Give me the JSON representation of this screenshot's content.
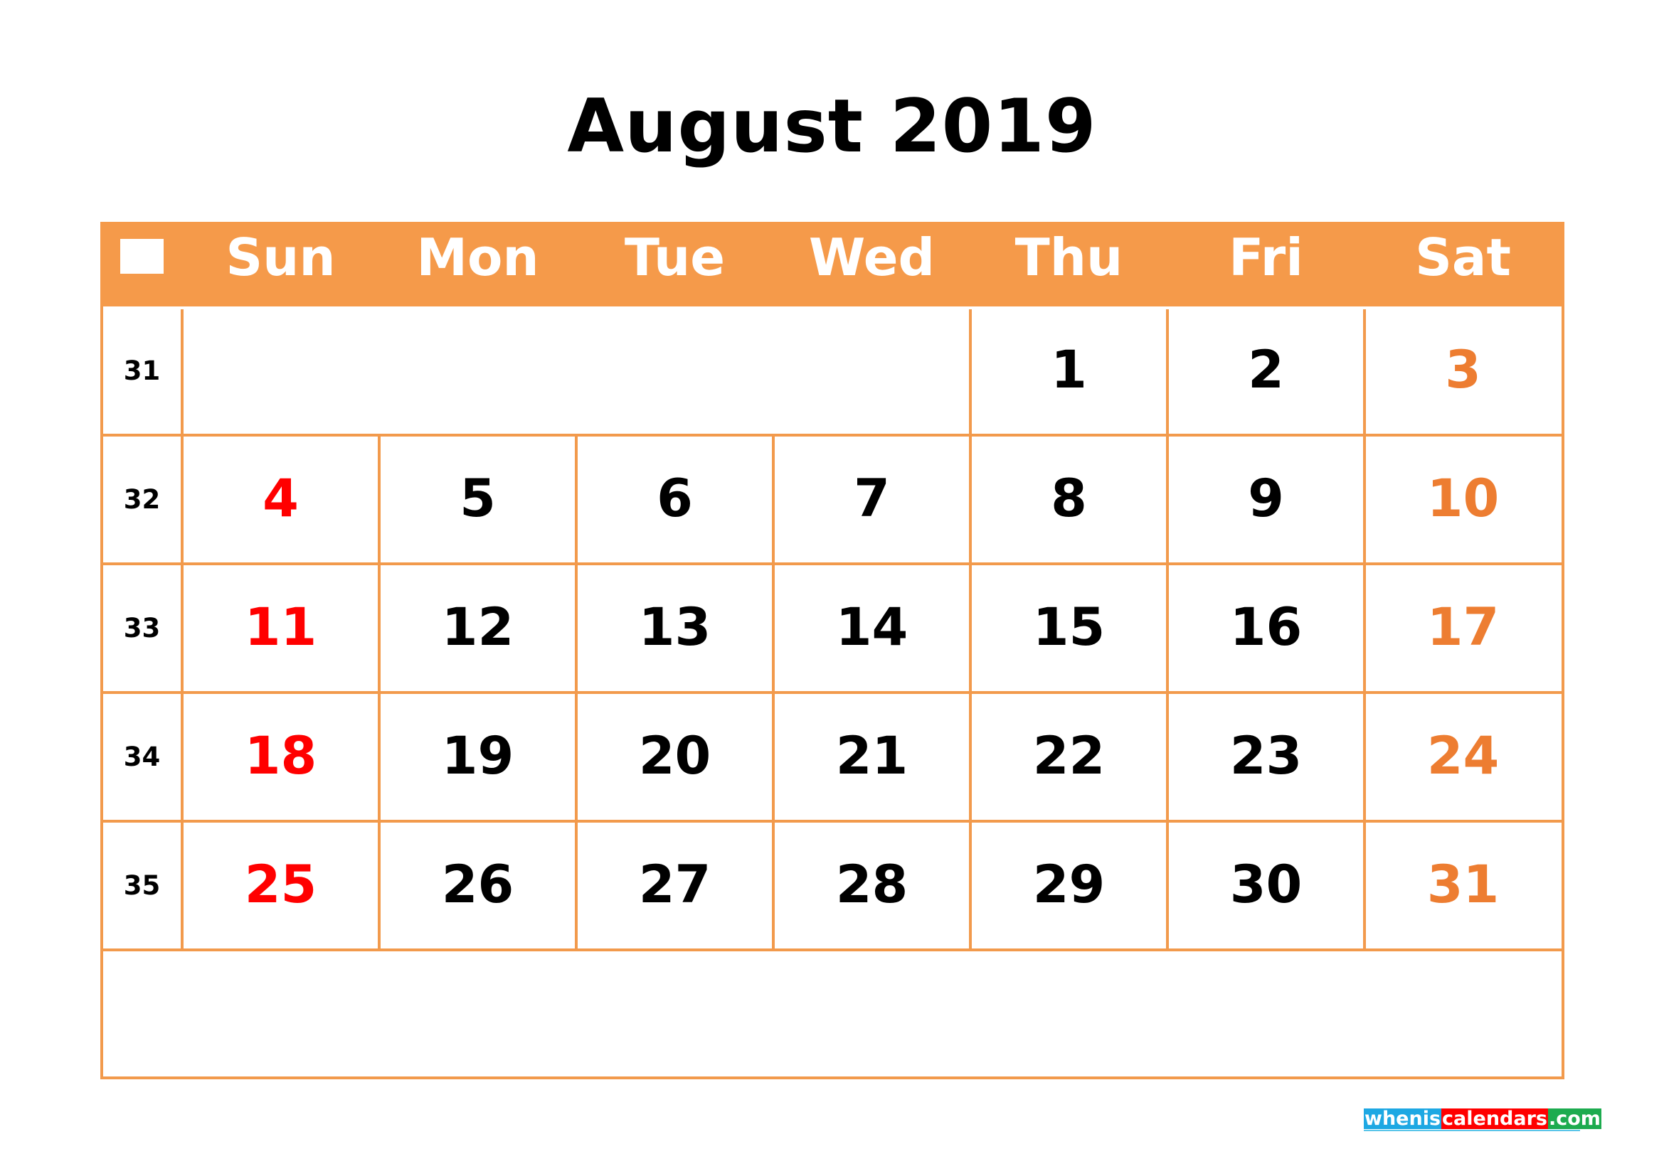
{
  "title": "August 2019",
  "header": {
    "days": [
      "Sun",
      "Mon",
      "Tue",
      "Wed",
      "Thu",
      "Fri",
      "Sat"
    ]
  },
  "weeks": [
    {
      "number": "31",
      "days": [
        "",
        "",
        "",
        "",
        "1",
        "2",
        "3"
      ]
    },
    {
      "number": "32",
      "days": [
        "4",
        "5",
        "6",
        "7",
        "8",
        "9",
        "10"
      ]
    },
    {
      "number": "33",
      "days": [
        "11",
        "12",
        "13",
        "14",
        "15",
        "16",
        "17"
      ]
    },
    {
      "number": "34",
      "days": [
        "18",
        "19",
        "20",
        "21",
        "22",
        "23",
        "24"
      ]
    },
    {
      "number": "35",
      "days": [
        "25",
        "26",
        "27",
        "28",
        "29",
        "30",
        "31"
      ]
    }
  ],
  "colors": {
    "header_bg": "#F59A4A",
    "grid": "#F29A4C",
    "sunday": "#FF0000",
    "saturday": "#ED7D31",
    "weekday": "#000000"
  },
  "logo": {
    "part1": "whenis",
    "part2": "calendars",
    "part3": ".com"
  }
}
